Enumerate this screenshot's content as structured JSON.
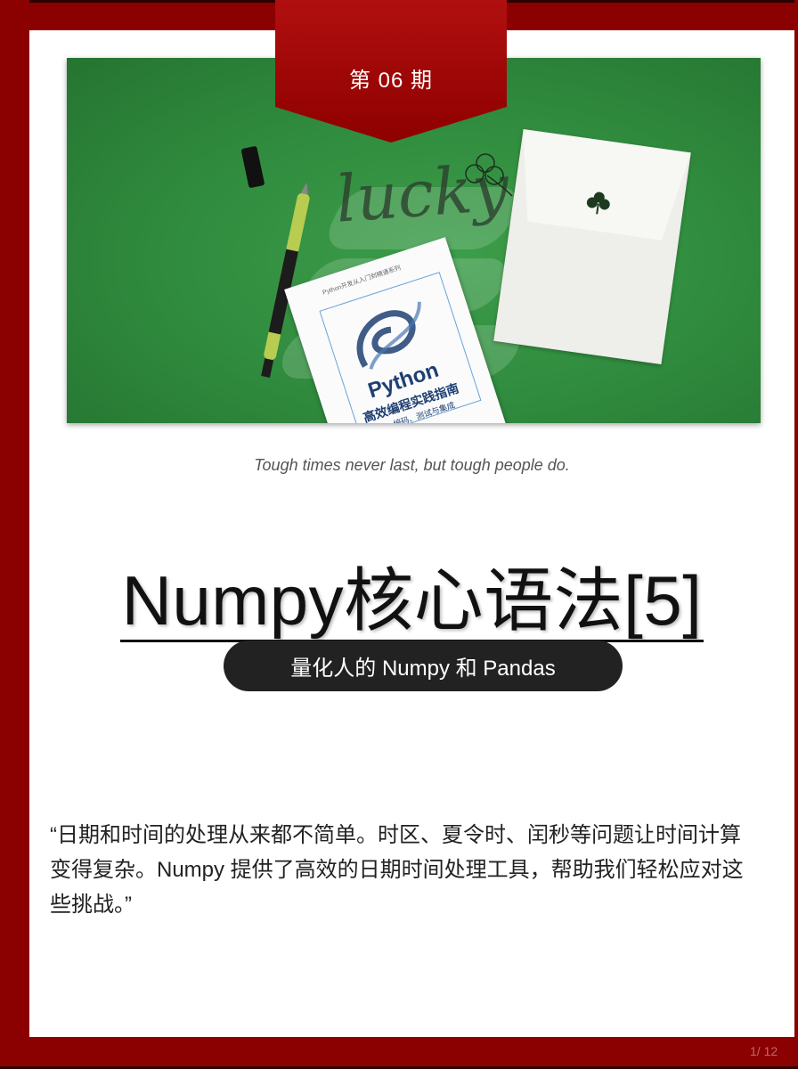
{
  "issue_label": "第 06 期",
  "quote_en": "Tough times never last, but tough people do.",
  "title": "Numpy核心语法[5]",
  "subtitle": "量化人的 Numpy 和 Pandas",
  "body": "“日期和时间的处理从来都不简单。时区、夏令时、闰秒等问题让时间计算变得复杂。Numpy 提供了高效的日期时间处理工具，帮助我们轻松应对这些挑战。”",
  "page_number": "1/ 12",
  "hero": {
    "handwriting": "lucky",
    "book_series": "Python开发从入门到精通系列",
    "book_title": "Python",
    "book_subtitle": "高效编程实践指南",
    "book_tagline": "编码、测试与集成"
  },
  "colors": {
    "frame": "#8b0000",
    "hero_green": "#2f8a3d",
    "pill": "#222222"
  }
}
